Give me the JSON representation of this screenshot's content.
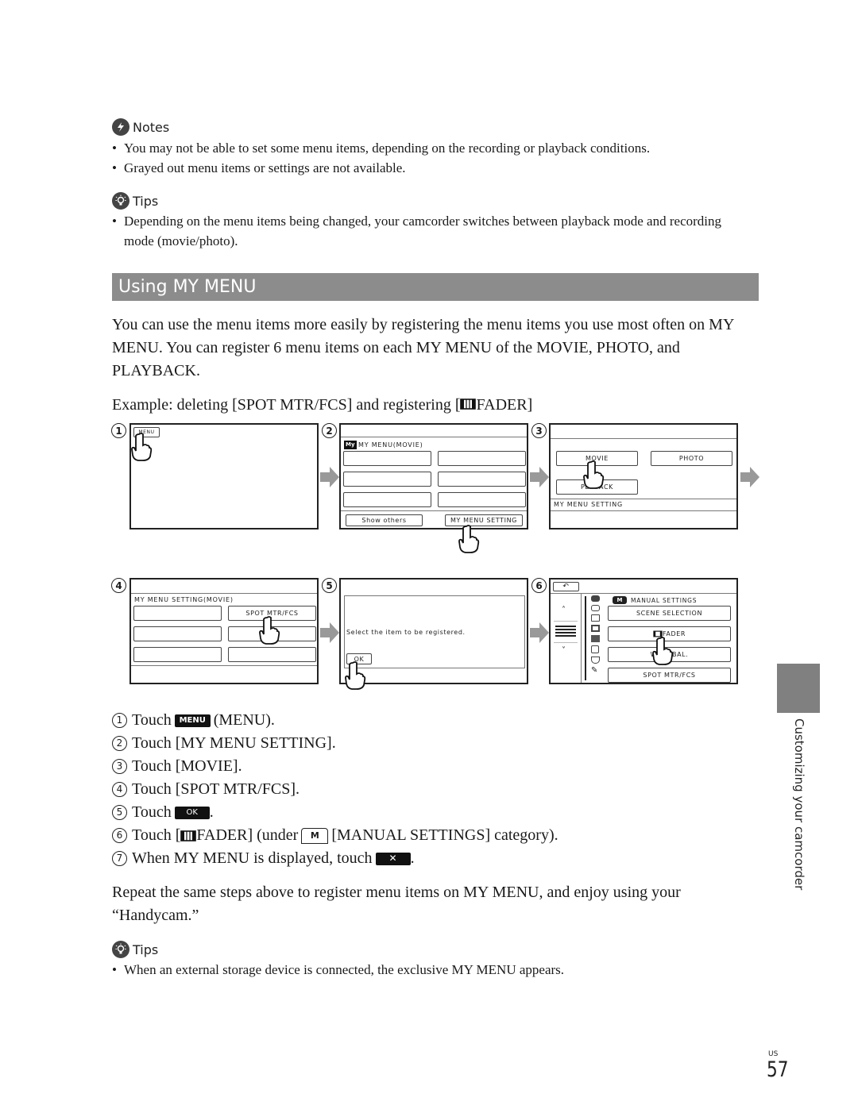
{
  "notes": {
    "title": "Notes",
    "items": [
      "You may not be able to set some menu items, depending on the recording or playback conditions.",
      "Grayed out menu items or settings are not available."
    ]
  },
  "tips_top": {
    "title": "Tips",
    "items": [
      "Depending on the menu items being changed, your camcorder switches between playback mode and recording mode (movie/photo)."
    ]
  },
  "section": {
    "heading": "Using MY MENU",
    "intro": "You can use the menu items more easily by registering the menu items you use most often on MY MENU. You can register 6 menu items on each MY MENU of the MOVIE, PHOTO, and PLAYBACK.",
    "example": "Example: deleting [SPOT MTR/FCS] and registering [",
    "example_tail": "FADER]"
  },
  "screens": {
    "s1": {
      "num": "1",
      "menu_btn": "MENU"
    },
    "s2": {
      "num": "2",
      "my_badge": "My",
      "title": "MY MENU(MOVIE)",
      "show_others": "Show others",
      "my_menu_setting": "MY MENU SETTING"
    },
    "s3": {
      "num": "3",
      "movie": "MOVIE",
      "photo": "PHOTO",
      "playback": "PL    ACK",
      "footer": "MY MENU SETTING"
    },
    "s4": {
      "num": "4",
      "title": "MY MENU SETTING(MOVIE)",
      "spot": "SPOT MTR/FCS"
    },
    "s5": {
      "num": "5",
      "message": "Select the item to be registered.",
      "ok": "OK"
    },
    "s6": {
      "num": "6",
      "back": "↶",
      "up": "˄",
      "down": "˅",
      "cat_badge": "M",
      "category": "MANUAL SETTINGS",
      "items": [
        "SCENE SELECTION",
        "FADER",
        "W      BAL.",
        "SPOT MTR/FCS"
      ]
    }
  },
  "steps": [
    {
      "num": "1",
      "pre": "Touch",
      "btn": "MENU",
      "post": "(MENU)."
    },
    {
      "num": "2",
      "text": "Touch [MY MENU SETTING]."
    },
    {
      "num": "3",
      "text": "Touch [MOVIE]."
    },
    {
      "num": "4",
      "text": "Touch [SPOT MTR/FCS]."
    },
    {
      "num": "5",
      "pre": "Touch",
      "btn": "OK",
      "post": "."
    },
    {
      "num": "6",
      "pre": "Touch [",
      "mid": "FADER] (under",
      "tab": "M",
      "post": "[MANUAL SETTINGS] category)."
    },
    {
      "num": "7",
      "pre": "When MY MENU is displayed, touch",
      "btn": "✕",
      "post": "."
    }
  ],
  "closing": "Repeat the same steps above to register menu items on MY MENU, and enjoy using your “Handycam.”",
  "tips_bottom": {
    "title": "Tips",
    "items": [
      "When an external storage device is connected, the exclusive MY MENU appears."
    ]
  },
  "side_tab": {
    "label": "Customizing your camcorder"
  },
  "page": {
    "region": "US",
    "number": "57"
  },
  "colors": {
    "heading_bar": "#8c8c8c",
    "side_tab": "#808080",
    "arrow": "#999999"
  }
}
